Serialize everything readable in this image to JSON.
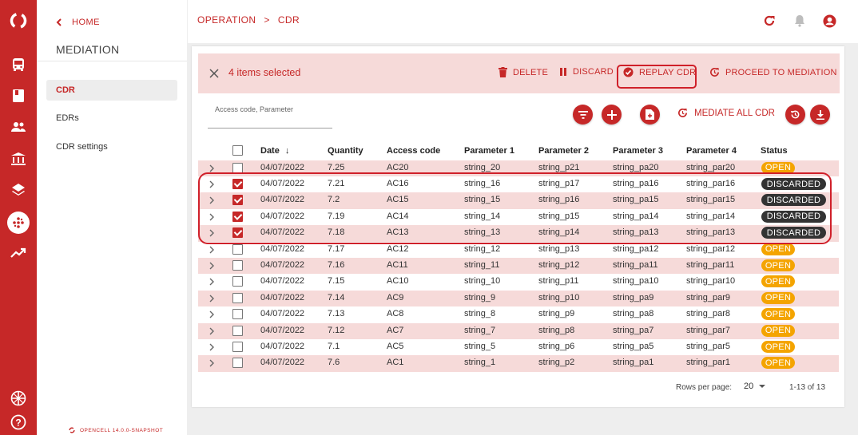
{
  "colors": {
    "brand": "#c62828",
    "row_alt": "#f6dad9",
    "open": "#f4a400",
    "discarded": "#333333"
  },
  "rail": {
    "icons": [
      "opencell-logo-icon",
      "bus-icon",
      "book-icon",
      "users-icon",
      "bank-icon",
      "layers-icon",
      "mediation-icon",
      "trend-icon",
      "language-icon",
      "help-icon"
    ]
  },
  "side": {
    "home_label": "HOME",
    "title": "MEDIATION",
    "items": [
      {
        "label": "CDR",
        "active": true
      },
      {
        "label": "EDRs",
        "active": false
      },
      {
        "label": "CDR settings",
        "active": false
      }
    ],
    "footer": "OPENCELL 14.0.0-SNAPSHOT"
  },
  "breadcrumb": {
    "part1": "OPERATION",
    "separator": ">",
    "part2": "CDR"
  },
  "selection": {
    "text": "4 items selected",
    "delete_label": "DELETE",
    "discard_label": "DISCARD",
    "replay_label": "REPLAY CDR",
    "proceed_label": "PROCEED TO MEDIATION"
  },
  "filter": {
    "placeholder": "Access code, Parameter"
  },
  "toolbar": {
    "mediate_all_label": "MEDIATE ALL CDR"
  },
  "table": {
    "columns": [
      "Date",
      "Quantity",
      "Access code",
      "Parameter 1",
      "Parameter 2",
      "Parameter 3",
      "Parameter 4",
      "Status"
    ],
    "sort_arrow": "↓",
    "rows": [
      {
        "checked": false,
        "date": "04/07/2022",
        "quantity": "7.25",
        "access": "AC20",
        "p1": "string_20",
        "p2": "string_p21",
        "p3": "string_pa20",
        "p4": "string_par20",
        "status": "OPEN"
      },
      {
        "checked": true,
        "date": "04/07/2022",
        "quantity": "7.21",
        "access": "AC16",
        "p1": "string_16",
        "p2": "string_p17",
        "p3": "string_pa16",
        "p4": "string_par16",
        "status": "DISCARDED"
      },
      {
        "checked": true,
        "date": "04/07/2022",
        "quantity": "7.2",
        "access": "AC15",
        "p1": "string_15",
        "p2": "string_p16",
        "p3": "string_pa15",
        "p4": "string_par15",
        "status": "DISCARDED"
      },
      {
        "checked": true,
        "date": "04/07/2022",
        "quantity": "7.19",
        "access": "AC14",
        "p1": "string_14",
        "p2": "string_p15",
        "p3": "string_pa14",
        "p4": "string_par14",
        "status": "DISCARDED"
      },
      {
        "checked": true,
        "date": "04/07/2022",
        "quantity": "7.18",
        "access": "AC13",
        "p1": "string_13",
        "p2": "string_p14",
        "p3": "string_pa13",
        "p4": "string_par13",
        "status": "DISCARDED"
      },
      {
        "checked": false,
        "date": "04/07/2022",
        "quantity": "7.17",
        "access": "AC12",
        "p1": "string_12",
        "p2": "string_p13",
        "p3": "string_pa12",
        "p4": "string_par12",
        "status": "OPEN"
      },
      {
        "checked": false,
        "date": "04/07/2022",
        "quantity": "7.16",
        "access": "AC11",
        "p1": "string_11",
        "p2": "string_p12",
        "p3": "string_pa11",
        "p4": "string_par11",
        "status": "OPEN"
      },
      {
        "checked": false,
        "date": "04/07/2022",
        "quantity": "7.15",
        "access": "AC10",
        "p1": "string_10",
        "p2": "string_p11",
        "p3": "string_pa10",
        "p4": "string_par10",
        "status": "OPEN"
      },
      {
        "checked": false,
        "date": "04/07/2022",
        "quantity": "7.14",
        "access": "AC9",
        "p1": "string_9",
        "p2": "string_p10",
        "p3": "string_pa9",
        "p4": "string_par9",
        "status": "OPEN"
      },
      {
        "checked": false,
        "date": "04/07/2022",
        "quantity": "7.13",
        "access": "AC8",
        "p1": "string_8",
        "p2": "string_p9",
        "p3": "string_pa8",
        "p4": "string_par8",
        "status": "OPEN"
      },
      {
        "checked": false,
        "date": "04/07/2022",
        "quantity": "7.12",
        "access": "AC7",
        "p1": "string_7",
        "p2": "string_p8",
        "p3": "string_pa7",
        "p4": "string_par7",
        "status": "OPEN"
      },
      {
        "checked": false,
        "date": "04/07/2022",
        "quantity": "7.1",
        "access": "AC5",
        "p1": "string_5",
        "p2": "string_p6",
        "p3": "string_pa5",
        "p4": "string_par5",
        "status": "OPEN"
      },
      {
        "checked": false,
        "date": "04/07/2022",
        "quantity": "7.6",
        "access": "AC1",
        "p1": "string_1",
        "p2": "string_p2",
        "p3": "string_pa1",
        "p4": "string_par1",
        "status": "OPEN"
      }
    ]
  },
  "pagination": {
    "rows_per_page_label": "Rows per page:",
    "rows_per_page": "20",
    "range": "1-13 of 13"
  }
}
